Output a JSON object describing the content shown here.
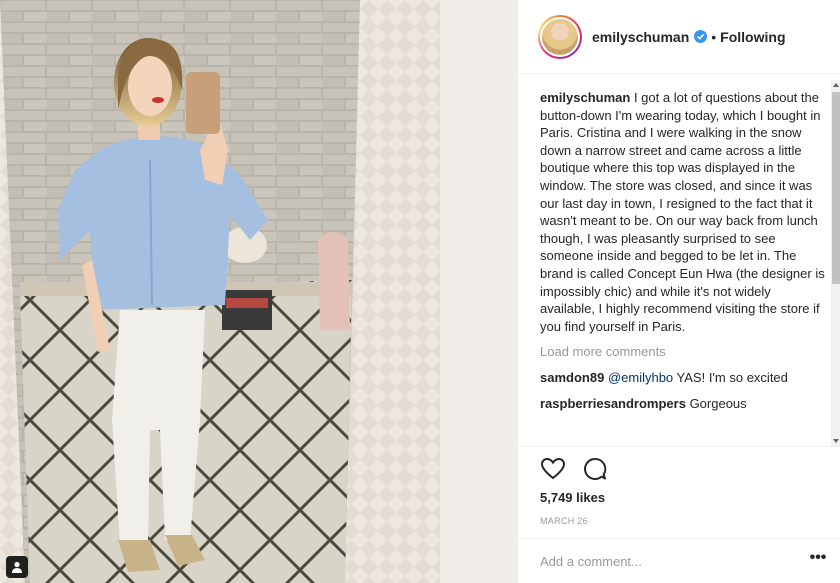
{
  "post": {
    "username": "emilyschuman",
    "separator": "•",
    "follow_status": "Following",
    "caption": {
      "username": "emilyschuman",
      "text": "I got a lot of questions about the button-down I'm wearing today, which I bought in Paris. Cristina and I were walking in the snow down a narrow street and came across a little boutique where this top was displayed in the window. The store was closed, and since it was our last day in town, I resigned to the fact that it wasn't meant to be. On our way back from lunch though, I was pleasantly surprised to see someone inside and begged to be let in. The brand is called Concept Eun Hwa (the designer is impossibly chic) and while it's not widely available, I highly recommend visiting the store if you find yourself in Paris."
    },
    "load_more_label": "Load more comments",
    "comments": [
      {
        "username": "samdon89",
        "mention": "@emilyhbo",
        "text": " YAS! I'm so excited"
      },
      {
        "username": "raspberriesandrompers",
        "mention": "",
        "text": " Gorgeous"
      }
    ],
    "likes": "5,749 likes",
    "date": "MARCH 26",
    "add_comment_placeholder": "Add a comment...",
    "more_options": "•••"
  },
  "icons": {
    "verified": "verified-badge-icon",
    "like": "heart-icon",
    "comment": "comment-bubble-icon",
    "tagged_user": "user-tag-icon",
    "more": "more-options-icon"
  },
  "colors": {
    "text": "#262626",
    "muted": "#999999",
    "verified": "#3897f0",
    "mention": "#003569",
    "divider": "#efefef"
  }
}
